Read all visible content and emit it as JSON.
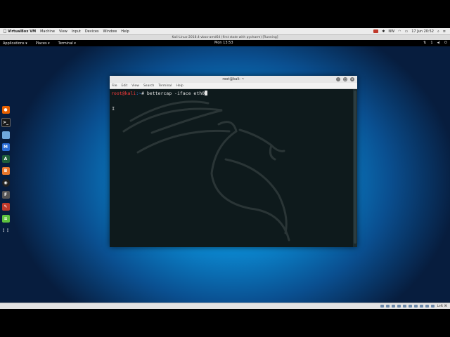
{
  "mac_menubar": {
    "apple": "",
    "items": [
      "VirtualBox VM",
      "Machine",
      "View",
      "Input",
      "Devices",
      "Window",
      "Help"
    ],
    "status": "NW",
    "datetime": "17 Jun  20:52"
  },
  "vm_title": "Kali-Linux-2018.4-vbox-amd64 (first state with pycharm) [Running]",
  "gnome_bar": {
    "applications": "Applications ▾",
    "places": "Places ▾",
    "terminal": "Terminal ▾",
    "clock": "Mon 13:53"
  },
  "dock": {
    "icons": [
      "firefox-icon",
      "terminal-icon",
      "files-icon",
      "metasploit-icon",
      "armitage-icon",
      "burp-icon",
      "maltego-icon",
      "faraday-icon",
      "leafpad-icon",
      "apps-grid-icon"
    ]
  },
  "terminal": {
    "title": "root@kali: ~",
    "menu": [
      "File",
      "Edit",
      "View",
      "Search",
      "Terminal",
      "Help"
    ],
    "prompt_user": "root@kali",
    "prompt_path": ":~",
    "prompt_symbol": "#",
    "command": " bettercap -iface eth0",
    "ibeam": "I"
  },
  "status_bar": {
    "host_key": "Left ⌘"
  },
  "colors": {
    "prompt_user": "#ff3b3b",
    "prompt_path": "#3b8bff",
    "terminal_bg": "#0e1a1c",
    "desktop_accent": "#1ec8ff"
  }
}
